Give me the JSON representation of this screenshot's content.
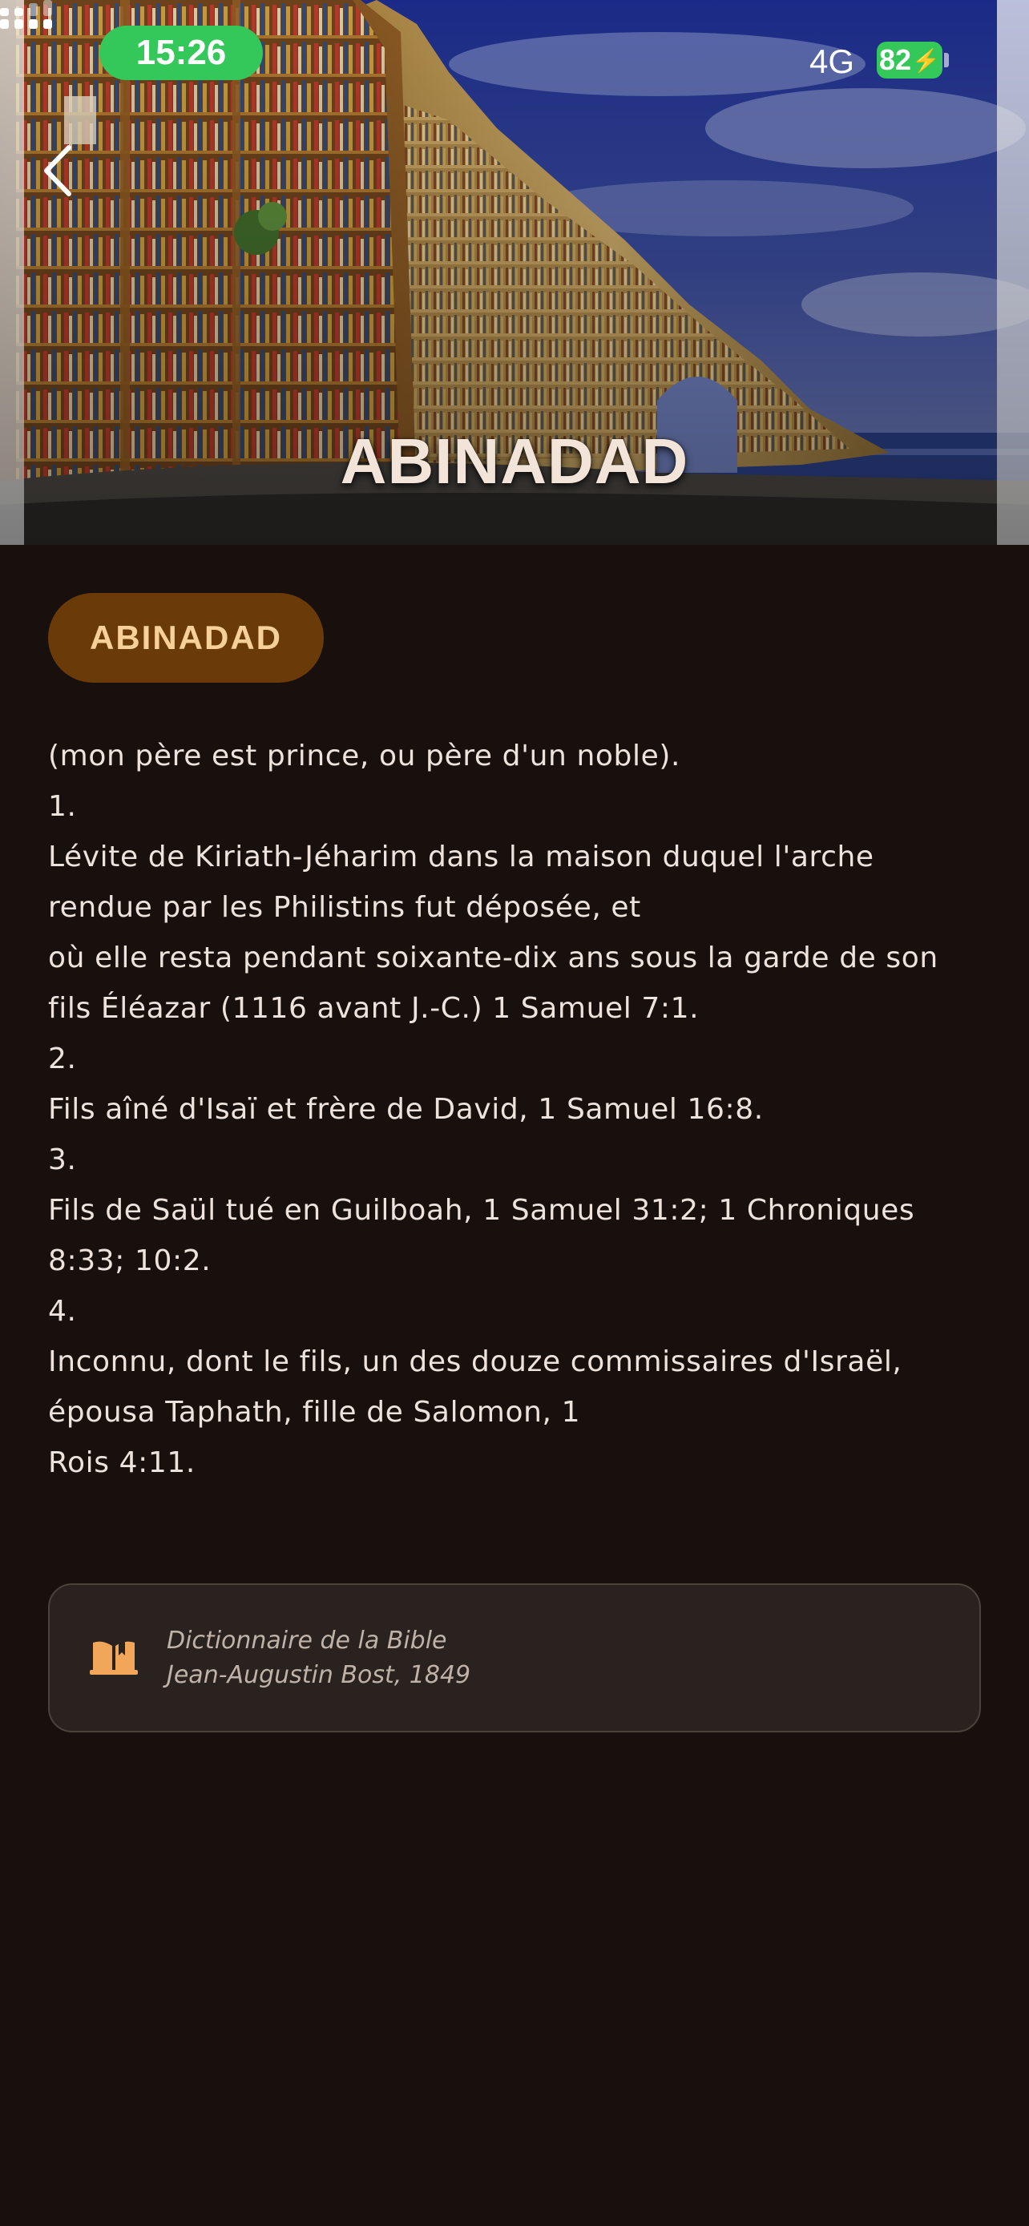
{
  "status_bar": {
    "time": "15:26",
    "network": "4G",
    "battery": "82"
  },
  "hero": {
    "title": "ABINADAD"
  },
  "entry": {
    "tag": "ABINADAD",
    "lines": [
      "(mon père est prince, ou père d'un noble).",
      "1.",
      "Lévite de Kiriath-Jéharim dans la maison duquel l'arche",
      "rendue par les Philistins fut déposée, et",
      "où elle resta pendant soixante-dix ans sous la garde de son",
      "fils Éléazar (1116 avant J.-C.) 1 Samuel 7:1.",
      "2.",
      "Fils aîné d'Isaï et frère de David, 1 Samuel 16:8.",
      "3.",
      "Fils de Saül tué en Guilboah, 1 Samuel 31:2; 1 Chroniques",
      "8:33; 10:2.",
      "4.",
      "Inconnu, dont le fils, un des douze commissaires d'Israël,",
      "épousa Taphath, fille de Salomon, 1",
      "Rois 4:11."
    ]
  },
  "source": {
    "title": "Dictionnaire de la Bible",
    "author": "Jean-Augustin Bost, 1849",
    "icon": "open-book-icon"
  },
  "colors": {
    "background": "#18100c",
    "pill": "#6a3a08",
    "pill_text": "#f7cf98",
    "accent_icon": "#f2a65a",
    "status_green": "#34c759"
  }
}
